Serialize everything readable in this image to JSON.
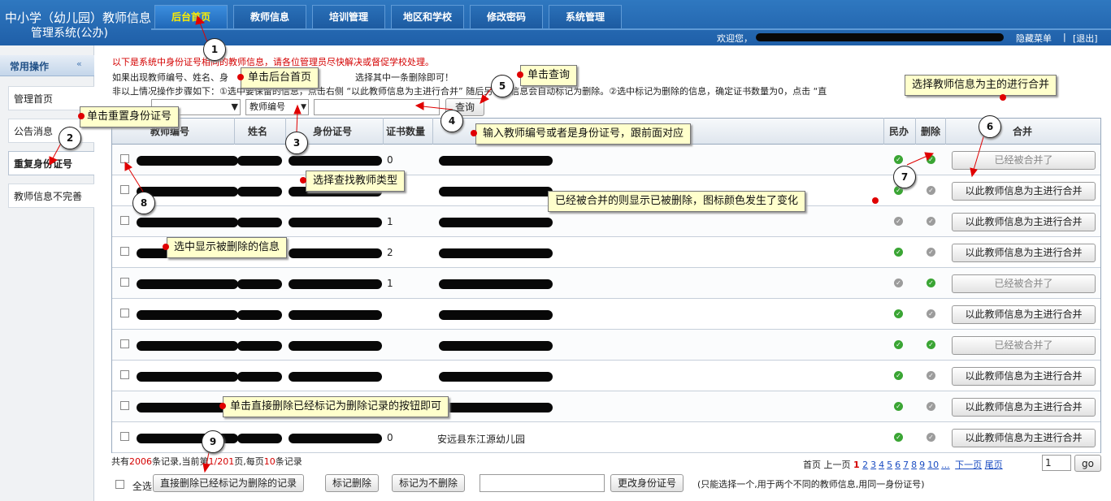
{
  "header": {
    "title_line1": "中小学（幼儿园）教师信息",
    "title_line2": "管理系统(公办)",
    "nav": [
      "后台首页",
      "教师信息",
      "培训管理",
      "地区和学校",
      "修改密码",
      "系统管理"
    ],
    "welcome": "欢迎您，",
    "hide_menu": "隐藏菜单",
    "separator": "|",
    "logout": "[退出]"
  },
  "sidebar": {
    "title": "常用操作",
    "toggle_icon": "«",
    "items": [
      "管理首页",
      "公告消息",
      "重复身份证号",
      "教师信息不完善"
    ]
  },
  "notice": {
    "line1": "以下是系统中身份证号相同的教师信息，请各位管理员尽快解决或督促学校处理。",
    "line2": "如果出现教师编号、姓名、身",
    "line2_end": "选择其中一条删除即可！",
    "line3": "非以上情况操作步骤如下：①选中要保留的信息，点击右侧 “以此教师信息为主进行合并” 随后另一条信息会自动标记为删除。②选中标记为删除的信息，确定证书数量为0，点击 “直"
  },
  "search": {
    "select1": "",
    "select2": "教师编号",
    "input_value": "",
    "button": "查询"
  },
  "table": {
    "headers": [
      "教师编号",
      "姓名",
      "身份证号",
      "证书数量",
      "",
      "民办",
      "删除",
      "合并"
    ],
    "merge_label": "以此教师信息为主进行合并",
    "merged_label": "已经被合并了",
    "rows": [
      {
        "cert": "0",
        "school": "",
        "minban": "green",
        "del": "green",
        "merged": true
      },
      {
        "cert": "",
        "school": "",
        "minban": "green",
        "del": "gray",
        "merged": false
      },
      {
        "cert": "1",
        "school": "",
        "minban": "gray",
        "del": "gray",
        "merged": false
      },
      {
        "cert": "2",
        "school": "",
        "minban": "green",
        "del": "gray",
        "merged": false
      },
      {
        "cert": "1",
        "school": "",
        "minban": "gray",
        "del": "green",
        "merged": true
      },
      {
        "cert": "",
        "school": "",
        "minban": "green",
        "del": "gray",
        "merged": false
      },
      {
        "cert": "",
        "school": "",
        "minban": "green",
        "del": "green",
        "merged": true
      },
      {
        "cert": "",
        "school": "",
        "minban": "green",
        "del": "gray",
        "merged": false
      },
      {
        "cert": "",
        "school": "",
        "minban": "green",
        "del": "gray",
        "merged": false
      },
      {
        "cert": "0",
        "school": "安远县东江源幼儿园",
        "minban": "green",
        "del": "gray",
        "merged": false
      }
    ]
  },
  "status": {
    "prefix": "共有",
    "total": "2006",
    "mid1": "条记录,当前第",
    "page": "1/201",
    "mid2": "页,每页",
    "per": "10",
    "suffix": "条记录"
  },
  "pager": {
    "first": "首页",
    "prev": "上一页",
    "current": "1",
    "pages": [
      "2",
      "3",
      "4",
      "5",
      "6",
      "7",
      "8",
      "9",
      "10",
      "..."
    ],
    "next": "下一页",
    "last": "尾页",
    "input": "1",
    "go": "go"
  },
  "bottom": {
    "select_all": "全选",
    "delete_marked": "直接删除已经标记为删除的记录",
    "mark_delete": "标记删除",
    "mark_undelete": "标记为不删除",
    "input_value": "",
    "change_id": "更改身份证号",
    "hint": "(只能选择一个,用于两个不同的教师信息,用同一身份证号)"
  },
  "annotations": [
    {
      "num": "1",
      "text": "单击后台首页"
    },
    {
      "num": "2",
      "text": "单击重置身份证号"
    },
    {
      "num": "3",
      "text": "选择查找教师类型"
    },
    {
      "num": "4",
      "text": "输入教师编号或者是身份证号，跟前面对应"
    },
    {
      "num": "5",
      "text": "单击查询"
    },
    {
      "num": "6",
      "text": "选择教师信息为主的进行合并"
    },
    {
      "num": "7",
      "text": "已经被合并的则显示已被删除，图标颜色发生了变化"
    },
    {
      "num": "8",
      "text": "选中显示被删除的信息"
    },
    {
      "num": "9",
      "text": "单击直接删除已经标记为删除记录的按钮即可"
    }
  ],
  "colors": {
    "header_blue": "#2f78c0",
    "active_tab_text": "#ffee00",
    "notice_red": "#d40000",
    "annotation_bg": "#ffffcc",
    "status_green": "#3aa534"
  }
}
